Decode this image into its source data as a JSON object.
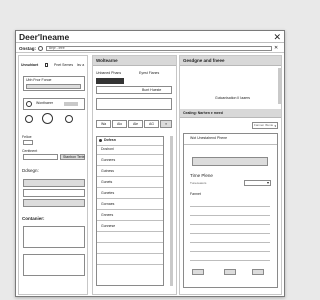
{
  "window": {
    "title": "Deer'lneame",
    "close_glyph": "✕"
  },
  "toolbar": {
    "label": "Onstag:",
    "field_value": "Bepr - ieee",
    "clear_glyph": "✕"
  },
  "sidebar": {
    "tabs": [
      "Unnuhiaet",
      "Pnet Semes",
      "lsv a"
    ],
    "selected_button": "Ubh Fnor Fonoe",
    "toggle_label": "Wonthaeer",
    "filter_label": "Felioe",
    "field_label": "Centtnent",
    "field_button": "Stanbon Terie",
    "section1_label": "Ddsegn:",
    "section2_label": "Contanier:"
  },
  "middle": {
    "header": "Woltearne",
    "subtabs": [
      "Unbaned Phans",
      "Eyest Fianes"
    ],
    "select_value": "Bunt Hueste",
    "segments": [
      "Wa",
      "Alo",
      "Ale",
      "AG"
    ],
    "list_header": "Dofesn",
    "list_items": [
      "Doshoni",
      "Gunnees",
      "Gutness",
      "Gunets",
      "Gunetes",
      "Gornaes",
      "Gnnees",
      "Gunnese"
    ]
  },
  "right": {
    "header": "Gesdgne and fneee",
    "caption": "Gutcanisation II Iaaers",
    "section_header": "Cealing: Narhen e meed",
    "search_placeholder": "Fannen Iftunie",
    "panel_header": "Wot Unestahend Phene",
    "field_label": "Tirne Plene",
    "field_hint": "Tuneceaiors",
    "field_sub": "Fannet"
  }
}
